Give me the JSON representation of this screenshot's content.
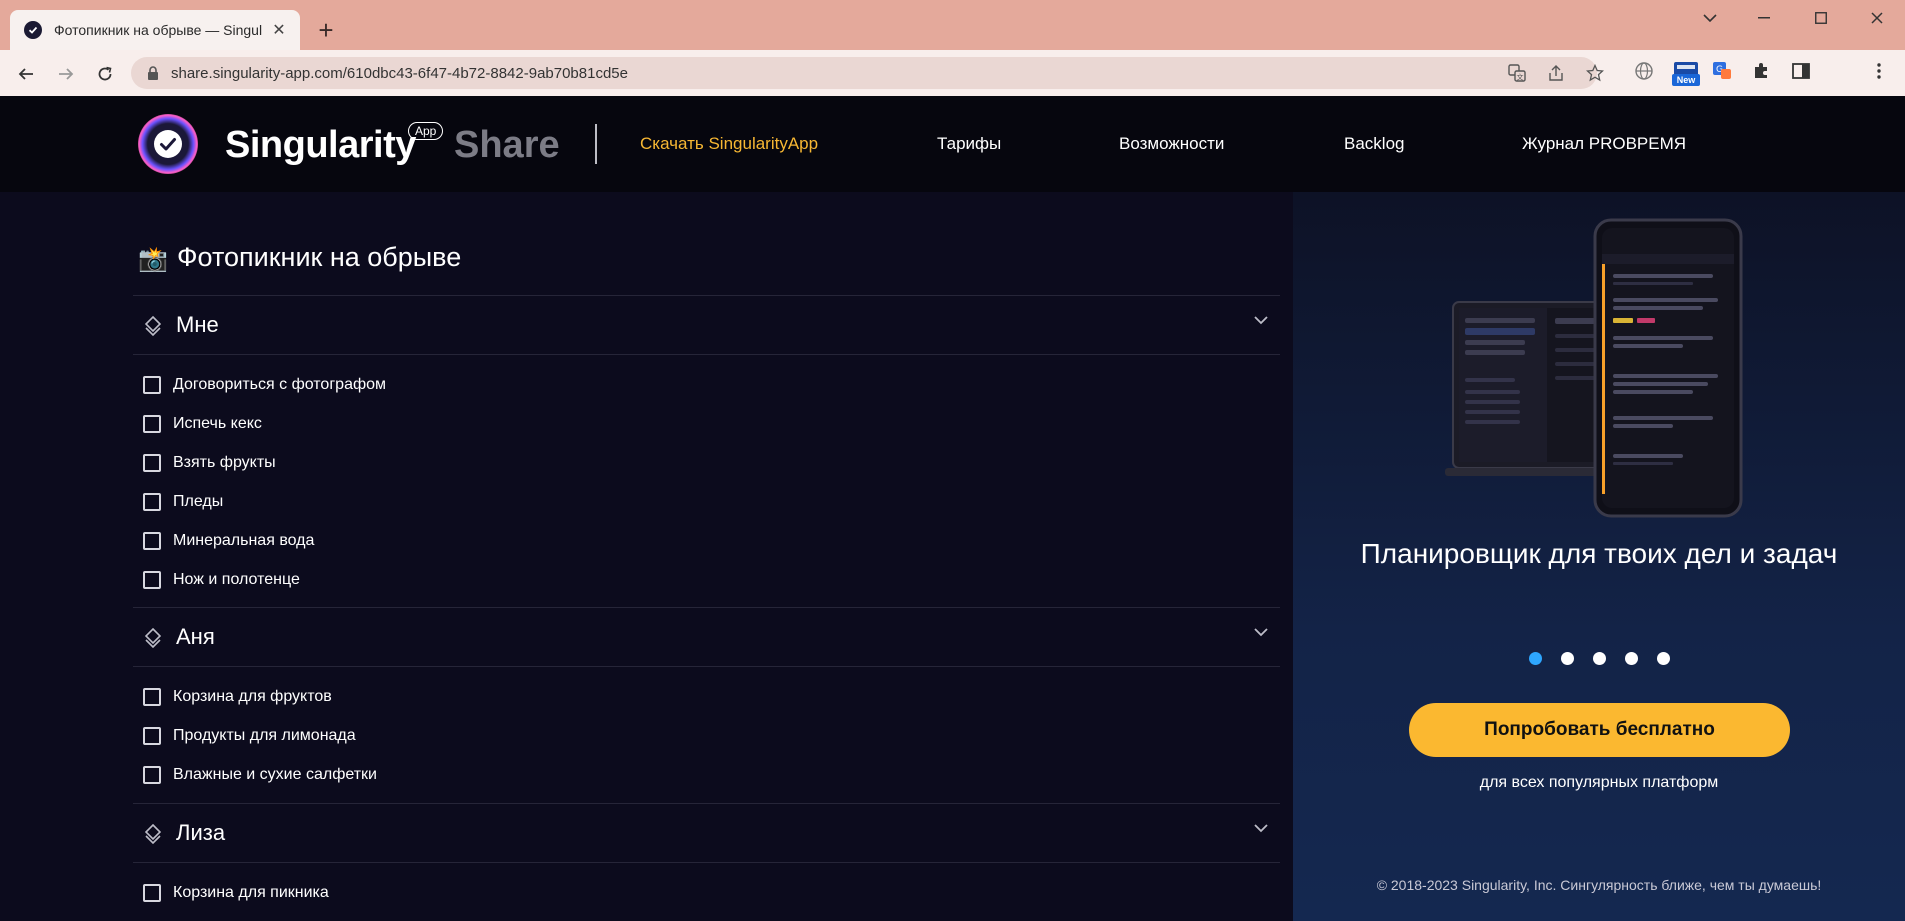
{
  "browser": {
    "tab_title": "Фотопикник на обрыве — Singularity",
    "url": "share.singularity-app.com/610dbc43-6f47-4b72-8842-9ab70b81cd5e",
    "extension_badge": "New"
  },
  "header": {
    "brand": "Singularity",
    "brand_badge": "App",
    "brand_share": "Share",
    "nav": [
      "Скачать SingularityApp",
      "Тарифы",
      "Возможности",
      "Backlog",
      "Журнал PROВРЕМЯ"
    ],
    "accent_color": "#f7b733"
  },
  "project": {
    "emoji": "📸",
    "title": "Фотопикник на обрыве",
    "sections": [
      {
        "title": "Мне",
        "tasks": [
          "Договориться с фотографом",
          "Испечь кекс",
          "Взять фрукты",
          "Пледы",
          "Минеральная вода",
          "Нож и полотенце"
        ]
      },
      {
        "title": "Аня",
        "tasks": [
          "Корзина для фруктов",
          "Продукты для лимонада",
          "Влажные и сухие салфетки"
        ]
      },
      {
        "title": "Лиза",
        "tasks": [
          "Корзина для пикника"
        ]
      }
    ]
  },
  "promo": {
    "title": "Планировщик для твоих дел и задач",
    "slides_total": 5,
    "slide_active": 1,
    "cta": "Попробовать бесплатно",
    "cta_sub": "для всех популярных платформ",
    "copyright": "© 2018-2023 Singularity, Inc. Сингулярность ближе, чем ты думаешь!",
    "cta_color": "#fbb830",
    "dot_active_color": "#2ea7ff"
  }
}
